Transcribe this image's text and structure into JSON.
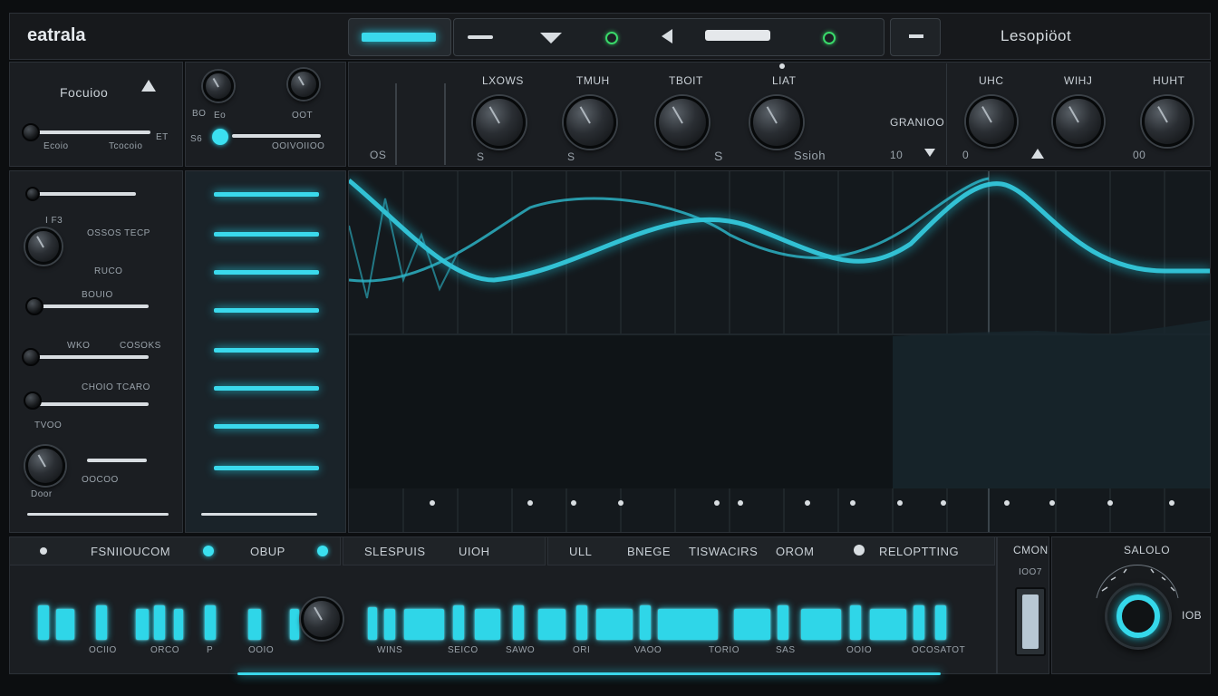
{
  "topbar": {
    "app_title": "eatrala",
    "preset_name": "Lesopiöot",
    "icons": [
      "minus-icon",
      "triangle-down-icon",
      "led-icon",
      "play-left-icon",
      "led-icon"
    ]
  },
  "left_top": {
    "title": "Focuioo",
    "labels": [
      "ET",
      "Ecoio",
      "Tcocoio"
    ]
  },
  "mid_top": {
    "labels": [
      "BO",
      "Eo",
      "OOT",
      "S6",
      "OOIVOIIOO"
    ]
  },
  "knob_row": {
    "labels": [
      "LXOWS",
      "TMUH",
      "TBOIT",
      "LIAT"
    ],
    "bottom_labels": [
      "OS",
      "S",
      "S",
      "S",
      "Ssioh"
    ],
    "right_group_label": "GRANIOO",
    "right_knob_labels": [
      "UHC",
      "WIHJ",
      "HUHT"
    ],
    "right_bottom_labels": [
      "10",
      "0",
      "00"
    ]
  },
  "left_side": {
    "labels": [
      "I F3",
      "OSSOS TECP",
      "RUCO",
      "BOUIO",
      "WKO",
      "COSOKS",
      "CHOIO TCARO",
      "TVOO",
      "OOCOO",
      "Door"
    ]
  },
  "bottom": {
    "group1_labels": [
      "FSNIIOUCOM",
      "OBUP"
    ],
    "group2_labels": [
      "SLESPUIS",
      "UIOH"
    ],
    "group3_labels": [
      "ULL",
      "BNEGE",
      "TISWACIRS",
      "OROM",
      "RELOPTTING"
    ],
    "group4_label": "CMON",
    "right_knob_label": "SALOLO",
    "right_value": "IOB",
    "fader_label": "IOO7",
    "bottom_row": [
      "OCIIO",
      "ORCO",
      "P",
      "OOIO",
      "WINS",
      "SEICO",
      "SAWO",
      "ORI",
      "VAOO",
      "TORIO",
      "SAS",
      "OOIO",
      "OCOSATOT"
    ]
  }
}
